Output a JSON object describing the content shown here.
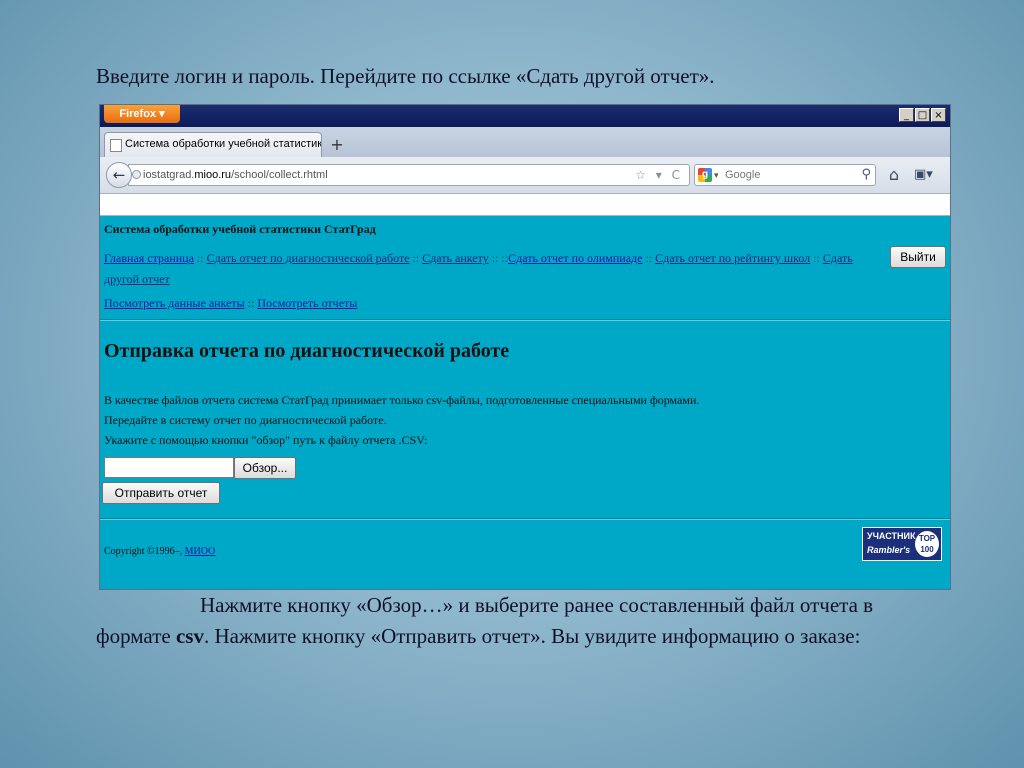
{
  "slide": {
    "title": "Введите логин и пароль. Перейдите по ссылке «Сдать другой отчет».",
    "body_part1": "Нажмите кнопку «Обзор…» и выберите ранее составленный файл отчета в формате ",
    "body_bold": "csv",
    "body_part2": ". Нажмите кнопку «Отправить отчет». Вы увидите информацию о заказе:"
  },
  "browser": {
    "app_button": "Firefox",
    "window_controls": {
      "minimize": "_",
      "maximize": "□",
      "close": "×"
    },
    "tab_title": "Система обработки учебной статистики ...",
    "new_tab": "+",
    "url_prefix": "iostatgrad.",
    "url_domain": "mioo.ru",
    "url_path": "/school/collect.rhtml",
    "url_icons": "☆ ▾ C",
    "search_engine_letter": "g",
    "search_placeholder": "Google",
    "icons": {
      "back": "back-arrow-icon",
      "home": "home-icon",
      "bookmarks": "bookmarks-icon",
      "search": "magnifier-icon"
    }
  },
  "page": {
    "site_title": "Система обработки учебной статистики СтатГрад",
    "logout": "Выйти",
    "menu": {
      "home": "Главная страница",
      "sep": "::",
      "diag": "Сдать отчет по диагностической работе",
      "survey": "Сдать анкету",
      "olymp": "Сдать отчет по олимпиаде",
      "rating": "Сдать отчет по рейтингу школ",
      "other": "Сдать другой отчет",
      "view_survey": "Посмотреть данные анкеты",
      "view_reports": "Посмотреть отчеты"
    },
    "heading": "Отправка отчета по диагностической работе",
    "instructions": [
      "В качестве файлов отчета система СтатГрад принимает только csv-файлы, подготовленные специальными формами.",
      "Передайте в систему отчет по диагностической работе.",
      "Укажите с помощью кнопки \"обзор\" путь к файлу отчета .CSV:"
    ],
    "file_value": "",
    "browse_label": "Обзор...",
    "submit_label": "Отправить отчет",
    "copyright_text": "Copyright ©1996–,",
    "copyright_link": "МИОО",
    "rambler": {
      "line1": "УЧАСТНИК",
      "line2": "Rambler's",
      "badge": "TOP 100"
    }
  },
  "colors": {
    "page_bg": "#00a8c8",
    "link": "#1a1aa0",
    "titlebar": "#0b1a5a",
    "firefox_orange": "#e86c0f"
  }
}
